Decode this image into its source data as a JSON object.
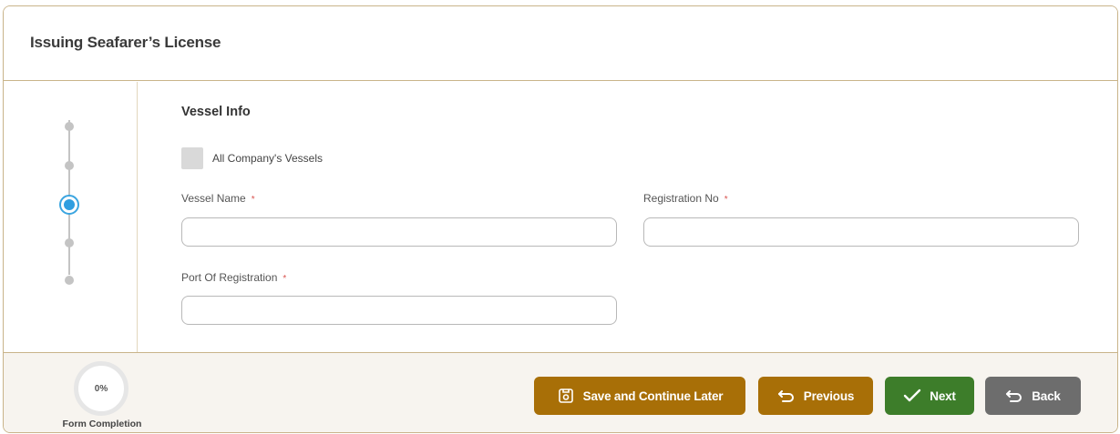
{
  "page": {
    "title": "Issuing Seafarer’s License"
  },
  "stepper": {
    "steps": 5,
    "active_step": 3
  },
  "section": {
    "title": "Vessel Info",
    "all_vessels_label": "All Company's Vessels",
    "vessel_name": {
      "label": "Vessel Name",
      "required_mark": "*",
      "value": "",
      "placeholder": ""
    },
    "registration_no": {
      "label": "Registration No",
      "required_mark": "*",
      "value": "",
      "placeholder": ""
    },
    "port_of_registration": {
      "label": "Port Of Registration",
      "required_mark": "*",
      "value": "",
      "placeholder": ""
    }
  },
  "footer": {
    "completion_percent": "0%",
    "completion_label": "Form Completion",
    "buttons": {
      "save_later": "Save and Continue Later",
      "previous": "Previous",
      "next": "Next",
      "back": "Back"
    }
  },
  "colors": {
    "accent_gold": "#a86f07",
    "next_green": "#3d7d2a",
    "back_gray": "#6d6d6d",
    "active_step_blue": "#2f9ee0",
    "border_tan": "#c9b48a"
  }
}
